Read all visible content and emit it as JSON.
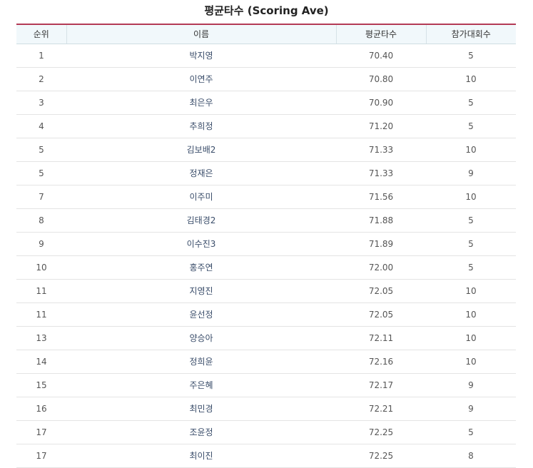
{
  "title": "평균타수 (Scoring Ave)",
  "columns": [
    "순위",
    "이름",
    "평균타수",
    "참가대회수"
  ],
  "rows": [
    {
      "rank": "1",
      "name": "박지영",
      "avg": "70.40",
      "events": "5"
    },
    {
      "rank": "2",
      "name": "이연주",
      "avg": "70.80",
      "events": "10"
    },
    {
      "rank": "3",
      "name": "최은우",
      "avg": "70.90",
      "events": "5"
    },
    {
      "rank": "4",
      "name": "추희정",
      "avg": "71.20",
      "events": "5"
    },
    {
      "rank": "5",
      "name": "김보배2",
      "avg": "71.33",
      "events": "10"
    },
    {
      "rank": "5",
      "name": "정재은",
      "avg": "71.33",
      "events": "9"
    },
    {
      "rank": "7",
      "name": "이주미",
      "avg": "71.56",
      "events": "10"
    },
    {
      "rank": "8",
      "name": "김태경2",
      "avg": "71.88",
      "events": "5"
    },
    {
      "rank": "9",
      "name": "이수진3",
      "avg": "71.89",
      "events": "5"
    },
    {
      "rank": "10",
      "name": "홍주연",
      "avg": "72.00",
      "events": "5"
    },
    {
      "rank": "11",
      "name": "지영진",
      "avg": "72.05",
      "events": "10"
    },
    {
      "rank": "11",
      "name": "윤선정",
      "avg": "72.05",
      "events": "10"
    },
    {
      "rank": "13",
      "name": "양승아",
      "avg": "72.11",
      "events": "10"
    },
    {
      "rank": "14",
      "name": "정희윤",
      "avg": "72.16",
      "events": "10"
    },
    {
      "rank": "15",
      "name": "주은혜",
      "avg": "72.17",
      "events": "9"
    },
    {
      "rank": "16",
      "name": "최민경",
      "avg": "72.21",
      "events": "9"
    },
    {
      "rank": "17",
      "name": "조윤정",
      "avg": "72.25",
      "events": "5"
    },
    {
      "rank": "17",
      "name": "최이진",
      "avg": "72.25",
      "events": "8"
    }
  ]
}
